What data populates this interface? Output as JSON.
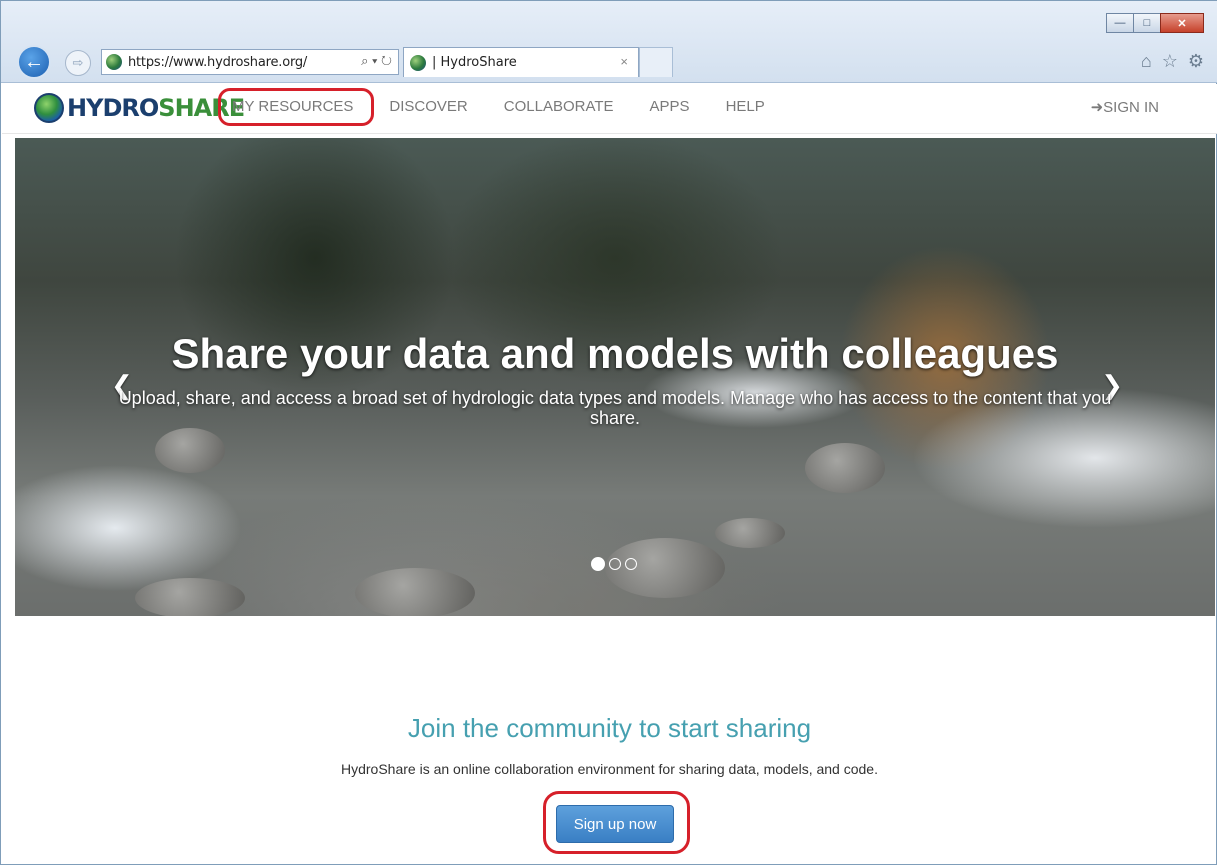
{
  "browser": {
    "url": "https://www.hydroshare.org/",
    "tab_title": "| HydroShare",
    "address_tools": "⌕ ▾ ↻",
    "tab_close": "×"
  },
  "site": {
    "logo_hydro": "HYDRO",
    "logo_share": "SHARE",
    "nav": {
      "my_resources": "MY RESOURCES",
      "discover": "DISCOVER",
      "collaborate": "COLLABORATE",
      "apps": "APPS",
      "help": "HELP",
      "sign_in": "SIGN IN"
    }
  },
  "hero": {
    "title": "Share your data and models with colleagues",
    "subtitle": "Upload, share, and access a broad set of hydrologic data types and models. Manage who has access to the content that you share.",
    "slide_count": 3,
    "active_slide": 1
  },
  "join": {
    "title": "Join the community to start sharing",
    "text": "HydroShare is an online collaboration environment for sharing data, models, and code.",
    "button": "Sign up now"
  },
  "colors": {
    "accent_teal": "#46a0b0",
    "button_blue": "#3a7fc4",
    "highlight_red": "#d6202a",
    "logo_blue": "#1b3f6e",
    "logo_green": "#3a8f3a"
  }
}
